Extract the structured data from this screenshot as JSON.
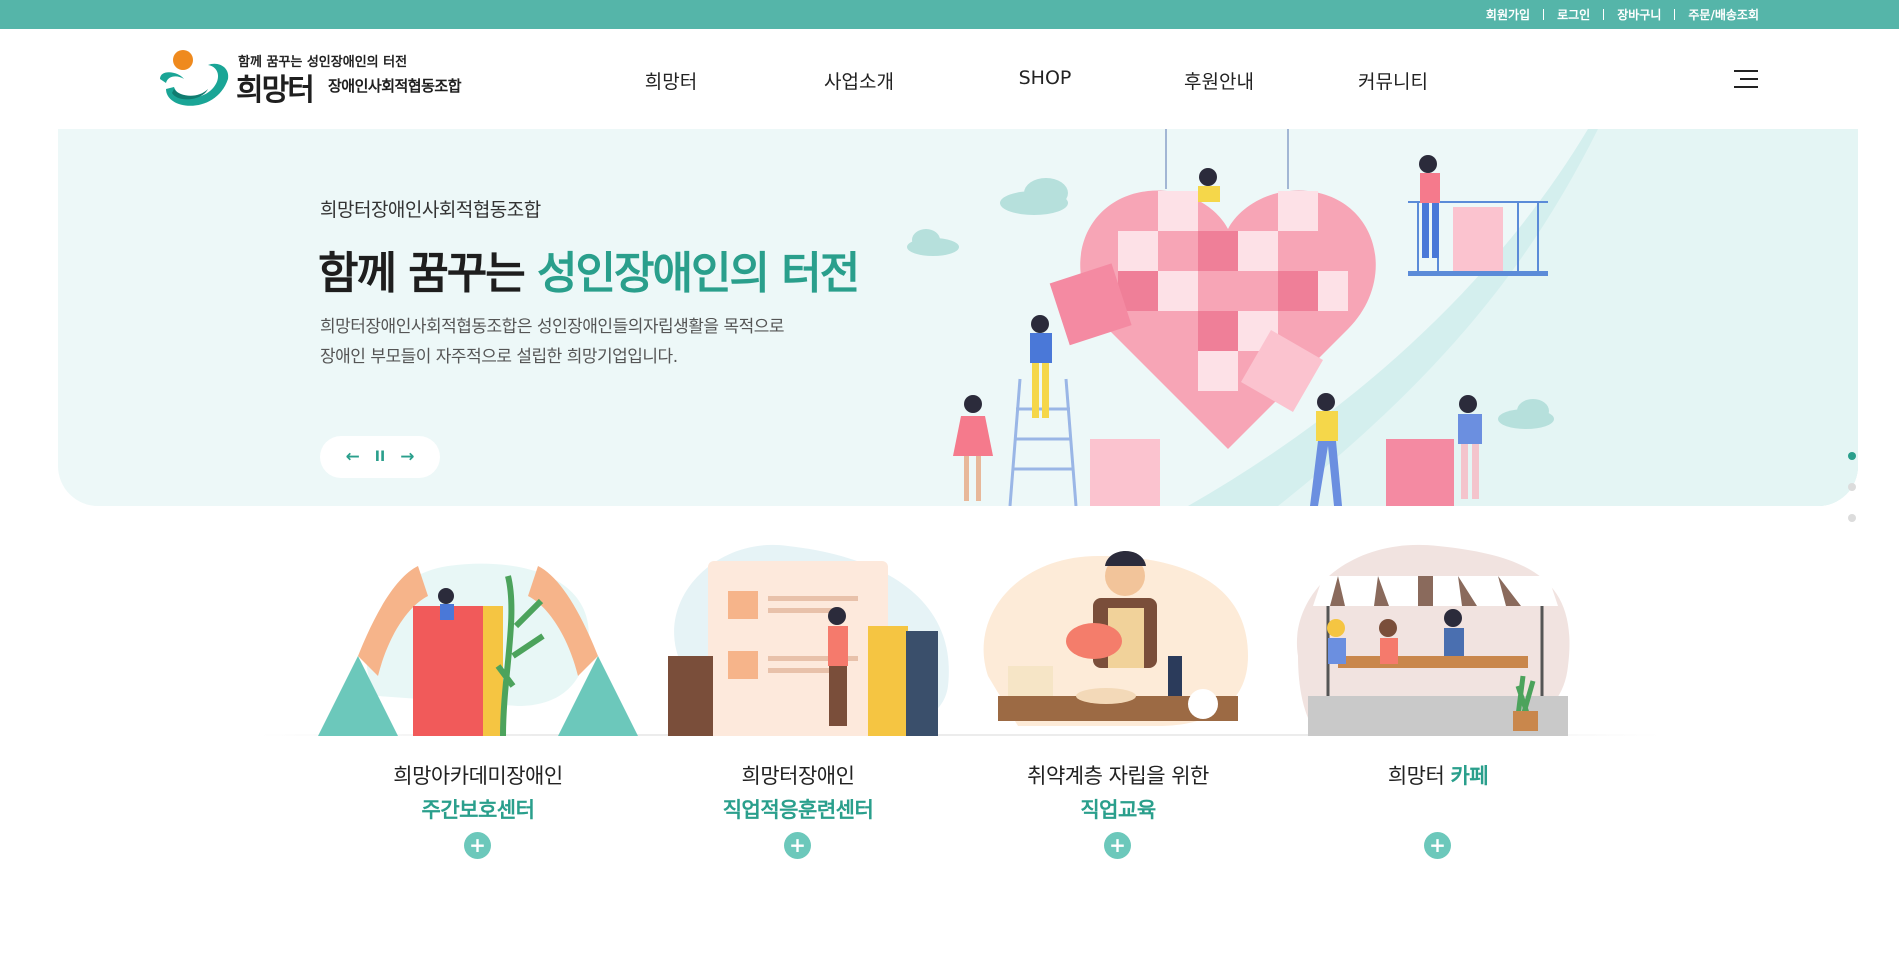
{
  "topbar": {
    "links": [
      "회원가입",
      "로그인",
      "장바구니",
      "주문/배송조회"
    ],
    "bg_color": "#55b5a9"
  },
  "header": {
    "logo": {
      "tagline": "함께 꿈꾸는 성인장애인의 터전",
      "name": "희망터",
      "subname": "장애인사회적협동조합"
    },
    "nav": [
      "희망터",
      "사업소개",
      "SHOP",
      "후원안내",
      "커뮤니티"
    ],
    "menu_icon": "hamburger-icon"
  },
  "hero": {
    "eyebrow": "희망터장애인사회적협동조합",
    "title_plain": "함께 꿈꾸는 ",
    "title_accent": "성인장애인의 터전",
    "desc_line1": "희망터장애인사회적협동조합은 성인장애인들의자립생활을 목적으로",
    "desc_line2": "장애인 부모들이 자주적으로 설립한 희망기업입니다.",
    "controls": {
      "prev": "←",
      "pause": "II",
      "next": "→"
    },
    "slides_total": 3,
    "slide_active": 1
  },
  "cards": [
    {
      "line1": "희망아카데미장애인",
      "line2": "주간보호센터",
      "icon": "book-plant-icon"
    },
    {
      "line1": "희망터장애인",
      "line2": "직업적응훈련센터",
      "icon": "resume-documents-icon"
    },
    {
      "line1": "취약계층 자립을 위한",
      "line2": "직업교육",
      "icon": "baker-icon"
    },
    {
      "line1_plain": "희망터 ",
      "line1_accent": "카페",
      "icon": "cafe-icon"
    }
  ],
  "card_more": "+",
  "colors": {
    "accent": "#2a9f8c",
    "mint": "#55b5a9",
    "hero_bg": "#edf8f8",
    "pink": "#f38ba3"
  }
}
